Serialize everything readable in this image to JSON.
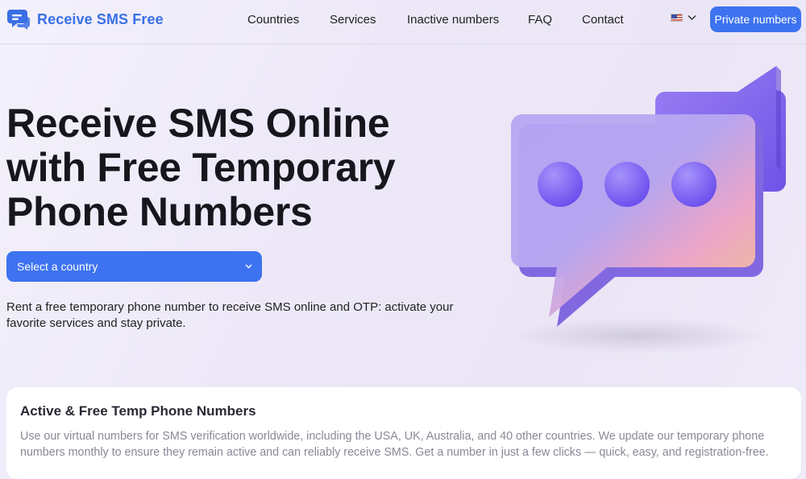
{
  "header": {
    "logo_text": "Receive SMS Free",
    "nav": [
      "Countries",
      "Services",
      "Inactive numbers",
      "FAQ",
      "Contact"
    ],
    "language_flag": "us-flag-icon",
    "private_button": "Private numbers"
  },
  "hero": {
    "title_lines": [
      "Receive SMS Online",
      "with Free Temporary",
      "Phone Numbers"
    ],
    "select_label": "Select a country",
    "description": "Rent a free temporary phone number to receive SMS online and OTP: activate your favorite services and stay private."
  },
  "section": {
    "title": "Active & Free Temp Phone Numbers",
    "body": "Use our virtual numbers for SMS verification worldwide, including the USA, UK, Australia, and 40 other countries. We update our temporary phone numbers monthly to ensure they remain active and can reliably receive SMS. Get a number in just a few clicks — quick, easy, and registration-free."
  },
  "colors": {
    "accent": "#3d73f0",
    "logo": "#3a6fe6",
    "bubble": "#8a6ff0",
    "dots": "#7b5ef2"
  }
}
